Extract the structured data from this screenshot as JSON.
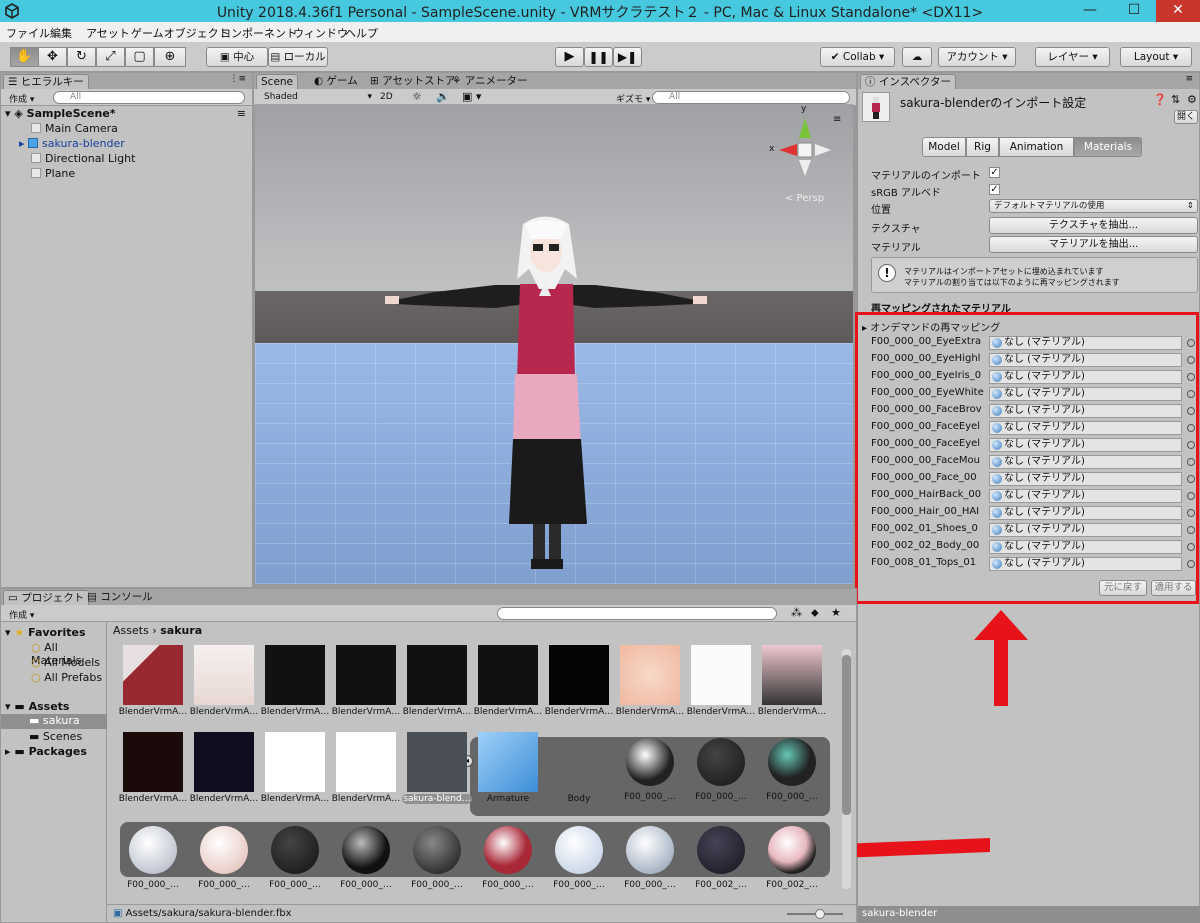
{
  "window": {
    "title": "Unity 2018.4.36f1 Personal - SampleScene.unity - VRMサクラテスト２ - PC, Mac & Linux Standalone* <DX11>",
    "minimize": "—",
    "maximize": "☐",
    "close": "✕"
  },
  "menu": [
    "ファイル",
    "編集",
    "アセット",
    "ゲームオブジェクト",
    "コンポーネント",
    "ウィンドウ",
    "ヘルプ"
  ],
  "toolbar": {
    "pivot": "中心",
    "space": "ローカル",
    "collab": "Collab ▾",
    "account": "アカウント",
    "layers": "レイヤー",
    "layout": "Layout"
  },
  "hierarchy": {
    "tab": "ヒエラルキー",
    "create": "作成",
    "search_placeholder": "All",
    "scene": "SampleScene*",
    "items": [
      "Main Camera",
      "sakura-blender",
      "Directional Light",
      "Plane"
    ]
  },
  "scene_tabs": [
    "Scene",
    "ゲーム",
    "アセットストア",
    "アニメーター"
  ],
  "scene_bar": {
    "shading": "Shaded",
    "mode2d": "2D",
    "gizmos": "ギズモ",
    "search": "All"
  },
  "scene_gizmo": {
    "axis_x": "x",
    "axis_y": "y",
    "persp": "< Persp"
  },
  "inspector": {
    "tab": "インスペクター",
    "title": "sakura-blenderのインポート設定",
    "open": "開く",
    "tabs": [
      "Model",
      "Rig",
      "Animation",
      "Materials"
    ],
    "active_tab": "Materials",
    "fields": {
      "import_label": "マテリアルのインポート",
      "srgb_label": "sRGB アルベド",
      "location_label": "位置",
      "location_value": "デフォルトマテリアルの使用",
      "textures_label": "テクスチャ",
      "textures_button": "テクスチャを抽出...",
      "materials_label": "マテリアル",
      "materials_button": "マテリアルを抽出..."
    },
    "info_line1": "マテリアルはインポートアセットに埋め込まれています",
    "info_line2": "マテリアルの割り当ては以下のように再マッピングされます",
    "remap_header": "再マッピングされたマテリアル",
    "ondemand": "オンデマンドの再マッピング",
    "rows": [
      "F00_000_00_EyeExtra",
      "F00_000_00_EyeHighl",
      "F00_000_00_EyeIris_0",
      "F00_000_00_EyeWhite",
      "F00_000_00_FaceBrov",
      "F00_000_00_FaceEyel",
      "F00_000_00_FaceEyel",
      "F00_000_00_FaceMou",
      "F00_000_00_Face_00",
      "F00_000_HairBack_00",
      "F00_000_Hair_00_HAI",
      "F00_002_01_Shoes_0",
      "F00_002_02_Body_00",
      "F00_008_01_Tops_01"
    ],
    "none_value": "なし (マテリアル)",
    "revert": "元に戻す",
    "apply": "適用する",
    "footer": "sakura-blender"
  },
  "project": {
    "tabs": [
      "プロジェクト",
      "コンソール"
    ],
    "create": "作成",
    "breadcrumb": [
      "Assets",
      "sakura"
    ],
    "favorites": "Favorites",
    "fav_items": [
      "All Materials",
      "All Models",
      "All Prefabs"
    ],
    "assets": "Assets",
    "asset_children": [
      "sakura",
      "Scenes"
    ],
    "packages": "Packages",
    "row1": [
      "BlenderVrmA…",
      "BlenderVrmA…",
      "BlenderVrmA…",
      "BlenderVrmA…",
      "BlenderVrmA…",
      "BlenderVrmA…",
      "BlenderVrmA…",
      "BlenderVrmA…",
      "BlenderVrmA…",
      "BlenderVrmA…"
    ],
    "row2": [
      "BlenderVrmA…",
      "BlenderVrmA…",
      "BlenderVrmA…",
      "BlenderVrmA…",
      "sakura-blend…",
      "Armature",
      "Body",
      "F00_000_…",
      "F00_000_…",
      "F00_000_…"
    ],
    "row3": [
      "F00_000_…",
      "F00_000_…",
      "F00_000_…",
      "F00_000_…",
      "F00_000_…",
      "F00_000_…",
      "F00_000_…",
      "F00_000_…",
      "F00_002_…",
      "F00_002_…"
    ],
    "status_path": "Assets/sakura/sakura-blender.fbx"
  },
  "colors": {
    "highlight": "#e8121a",
    "selection": "#3e7cd6"
  }
}
